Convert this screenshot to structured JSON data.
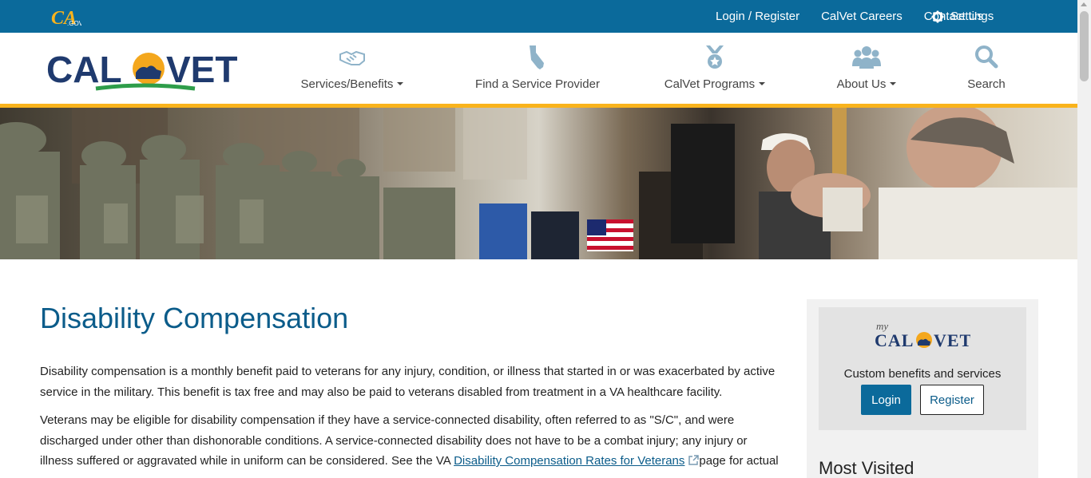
{
  "utility_bar": {
    "ca_gov_label": ".GOV",
    "links": [
      "Login / Register",
      "CalVet Careers",
      "Contact Us"
    ],
    "settings_label": "Settings"
  },
  "brand": {
    "logo_text": "CALVET",
    "colors": {
      "primary": "#0b6a9b",
      "accent": "#f9b31c",
      "navy": "#1f3a6e",
      "green": "#2e9d4a"
    }
  },
  "nav": {
    "items": [
      {
        "label": "Services/Benefits",
        "icon": "handshake-icon",
        "dropdown": true
      },
      {
        "label": "Find a Service Provider",
        "icon": "california-map-icon",
        "dropdown": false
      },
      {
        "label": "CalVet Programs",
        "icon": "medal-icon",
        "dropdown": true
      },
      {
        "label": "About Us",
        "icon": "people-group-icon",
        "dropdown": true
      },
      {
        "label": "Search",
        "icon": "search-icon",
        "dropdown": false
      }
    ]
  },
  "main": {
    "title": "Disability Compensation",
    "p1": "Disability compensation is a monthly benefit paid to veterans for any injury, condition, or illness that started in or was exacerbated by active service in the military. This benefit is tax free and may also be paid to veterans disabled from treatment in a VA healthcare facility.",
    "p2_start": "Veterans may be eligible for disability compensation if they have a service-connected disability, often referred to as \"S/C\", and were discharged under other than dishonorable conditions. A service-connected disability does not have to be a combat injury; any injury or illness suffered or aggravated while in uniform can be considered. See the VA ",
    "p2_link": "Disability Compensation Rates for Veterans",
    "p2_end": "page for actual"
  },
  "sidebar": {
    "mycalvet_my": "my",
    "mycalvet_name": "CALVET",
    "tagline": "Custom benefits and services",
    "login_label": "Login",
    "register_label": "Register",
    "most_visited": "Most Visited"
  }
}
